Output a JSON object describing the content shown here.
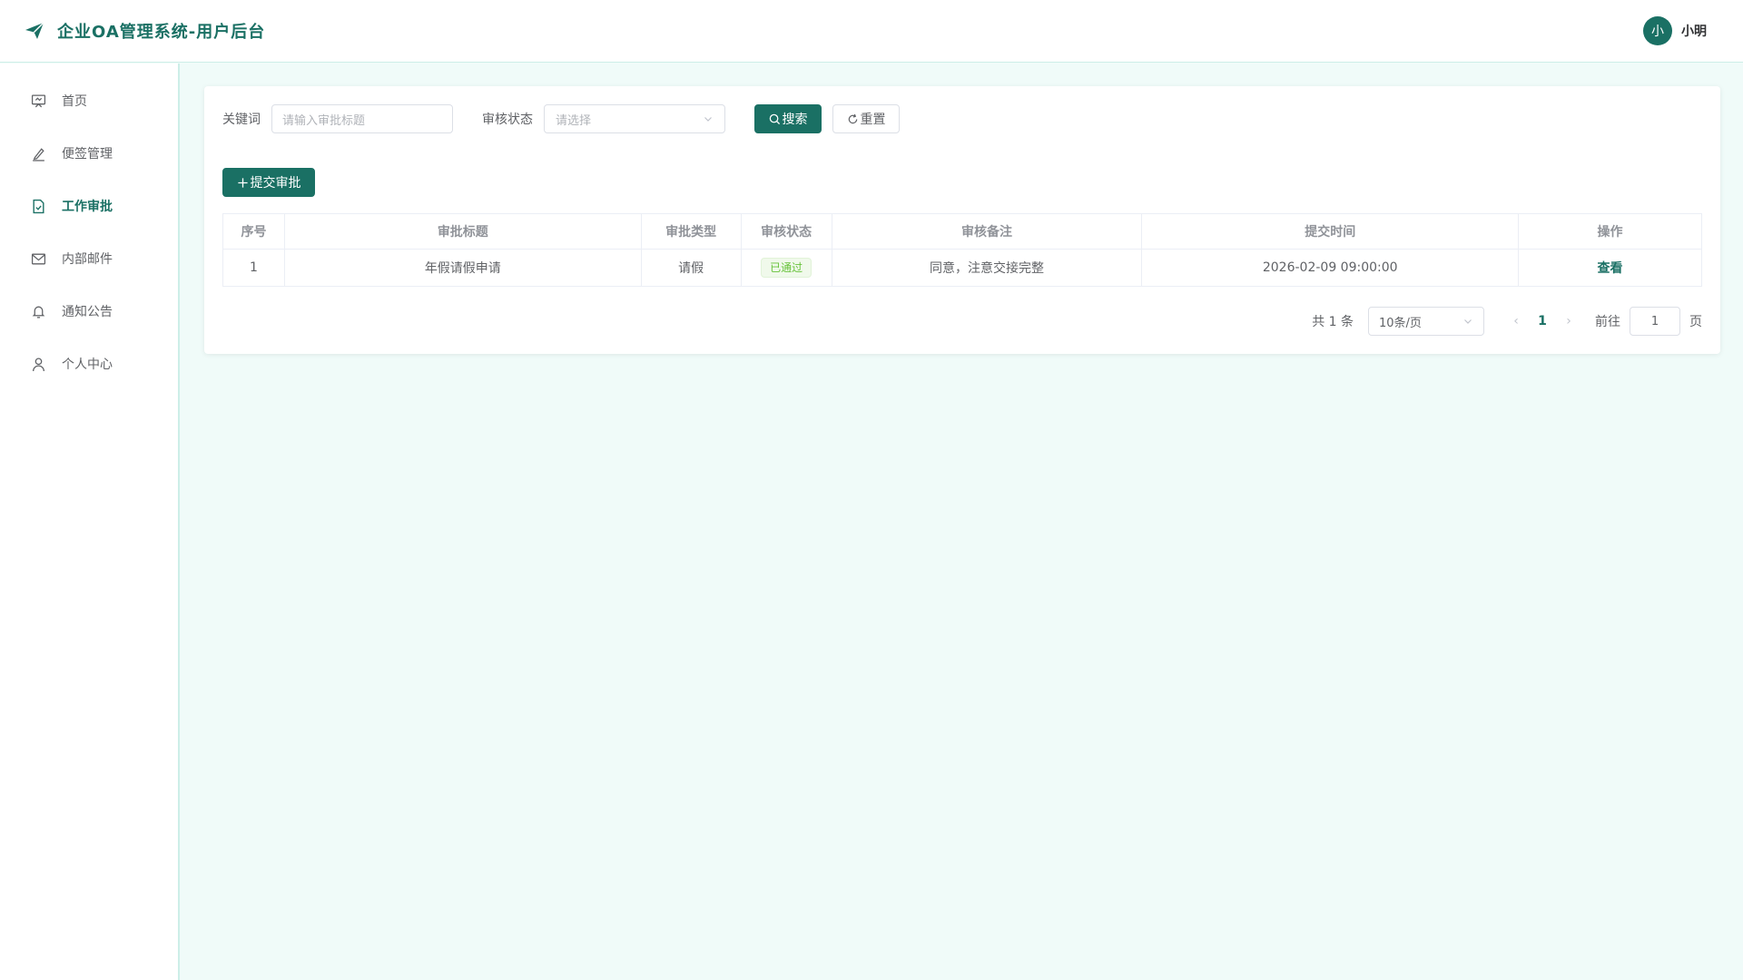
{
  "header": {
    "title": "企业OA管理系统-用户后台",
    "avatar_text": "小",
    "user_name": "小明"
  },
  "sidebar": {
    "items": [
      {
        "label": "首页",
        "icon": "monitor-icon"
      },
      {
        "label": "便签管理",
        "icon": "edit-icon"
      },
      {
        "label": "工作审批",
        "icon": "document-check-icon",
        "active": true
      },
      {
        "label": "内部邮件",
        "icon": "mail-icon"
      },
      {
        "label": "通知公告",
        "icon": "bell-icon"
      },
      {
        "label": "个人中心",
        "icon": "user-icon"
      }
    ]
  },
  "filters": {
    "keyword_label": "关键词",
    "keyword_placeholder": "请输入审批标题",
    "status_label": "审核状态",
    "status_placeholder": "请选择",
    "search_label": "搜索",
    "reset_label": "重置"
  },
  "actions": {
    "add_label": "提交审批"
  },
  "table": {
    "columns": [
      "序号",
      "审批标题",
      "审批类型",
      "审核状态",
      "审核备注",
      "提交时间",
      "操作"
    ],
    "rows": [
      {
        "index": "1",
        "title": "年假请假申请",
        "type": "请假",
        "status": "已通过",
        "remark": "同意，注意交接完整",
        "time": "2026-02-09 09:00:00",
        "action": "查看"
      }
    ]
  },
  "pagination": {
    "total_text": "共 1 条",
    "page_size": "10条/页",
    "current_page": "1",
    "goto_label": "前往",
    "goto_value": "1",
    "page_suffix": "页"
  },
  "colors": {
    "brand": "#1a7064",
    "background": "#f0fbf9",
    "success": "#67c23a"
  }
}
